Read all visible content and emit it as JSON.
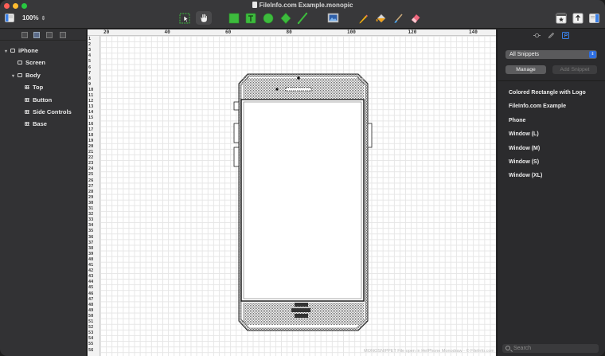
{
  "window": {
    "title": "FileInfo.com Example.monopic"
  },
  "toolbar": {
    "zoom": "100%",
    "zoom_stepper": "⇕"
  },
  "layers": [
    {
      "label": "iPhone",
      "indent": 0,
      "arrow": "▾",
      "icon": "folder"
    },
    {
      "label": "Screen",
      "indent": 1,
      "arrow": "",
      "icon": "box"
    },
    {
      "label": "Body",
      "indent": 1,
      "arrow": "▾",
      "icon": "folder"
    },
    {
      "label": "Top",
      "indent": 2,
      "arrow": "",
      "icon": "grid"
    },
    {
      "label": "Button",
      "indent": 2,
      "arrow": "",
      "icon": "grid"
    },
    {
      "label": "Side Controls",
      "indent": 2,
      "arrow": "",
      "icon": "grid"
    },
    {
      "label": "Base",
      "indent": 2,
      "arrow": "",
      "icon": "grid"
    }
  ],
  "ruler": {
    "top_labels": [
      "20",
      "40",
      "60",
      "80",
      "100",
      "120",
      "140"
    ],
    "left_start": 1,
    "left_end": 56
  },
  "canvas": {
    "footer": "MONOSNIPPET File open in HelPhone Monodraw - © FileInfo.com"
  },
  "inspector": {
    "snippet_filter": "All Snippets",
    "manage_label": "Manage",
    "add_snippet_label": "Add Snippet",
    "snippets": [
      "Colored Rectangle with Logo",
      "FileInfo.com Example",
      "Phone",
      "Window (L)",
      "Window (M)",
      "Window (S)",
      "Window (XL)"
    ],
    "search_placeholder": "Search"
  },
  "colors": {
    "accent": "#2f6fe0",
    "shape_green": "#3dbb3d",
    "traffic_close": "#ff5f57",
    "traffic_min": "#febc2e",
    "traffic_max": "#28c840"
  }
}
